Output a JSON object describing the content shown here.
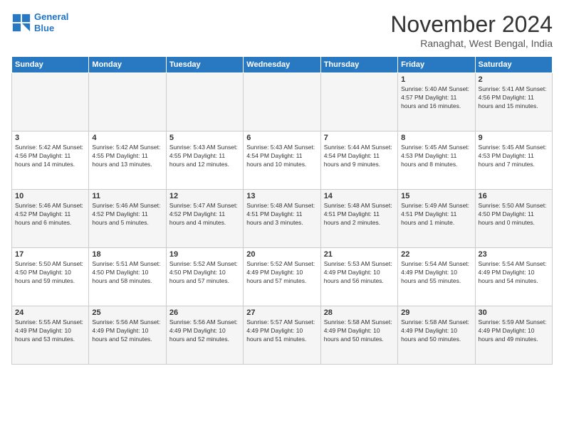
{
  "logo": {
    "line1": "General",
    "line2": "Blue"
  },
  "title": "November 2024",
  "subtitle": "Ranaghat, West Bengal, India",
  "headers": [
    "Sunday",
    "Monday",
    "Tuesday",
    "Wednesday",
    "Thursday",
    "Friday",
    "Saturday"
  ],
  "weeks": [
    [
      {
        "day": "",
        "content": ""
      },
      {
        "day": "",
        "content": ""
      },
      {
        "day": "",
        "content": ""
      },
      {
        "day": "",
        "content": ""
      },
      {
        "day": "",
        "content": ""
      },
      {
        "day": "1",
        "content": "Sunrise: 5:40 AM\nSunset: 4:57 PM\nDaylight: 11 hours\nand 16 minutes."
      },
      {
        "day": "2",
        "content": "Sunrise: 5:41 AM\nSunset: 4:56 PM\nDaylight: 11 hours\nand 15 minutes."
      }
    ],
    [
      {
        "day": "3",
        "content": "Sunrise: 5:42 AM\nSunset: 4:56 PM\nDaylight: 11 hours\nand 14 minutes."
      },
      {
        "day": "4",
        "content": "Sunrise: 5:42 AM\nSunset: 4:55 PM\nDaylight: 11 hours\nand 13 minutes."
      },
      {
        "day": "5",
        "content": "Sunrise: 5:43 AM\nSunset: 4:55 PM\nDaylight: 11 hours\nand 12 minutes."
      },
      {
        "day": "6",
        "content": "Sunrise: 5:43 AM\nSunset: 4:54 PM\nDaylight: 11 hours\nand 10 minutes."
      },
      {
        "day": "7",
        "content": "Sunrise: 5:44 AM\nSunset: 4:54 PM\nDaylight: 11 hours\nand 9 minutes."
      },
      {
        "day": "8",
        "content": "Sunrise: 5:45 AM\nSunset: 4:53 PM\nDaylight: 11 hours\nand 8 minutes."
      },
      {
        "day": "9",
        "content": "Sunrise: 5:45 AM\nSunset: 4:53 PM\nDaylight: 11 hours\nand 7 minutes."
      }
    ],
    [
      {
        "day": "10",
        "content": "Sunrise: 5:46 AM\nSunset: 4:52 PM\nDaylight: 11 hours\nand 6 minutes."
      },
      {
        "day": "11",
        "content": "Sunrise: 5:46 AM\nSunset: 4:52 PM\nDaylight: 11 hours\nand 5 minutes."
      },
      {
        "day": "12",
        "content": "Sunrise: 5:47 AM\nSunset: 4:52 PM\nDaylight: 11 hours\nand 4 minutes."
      },
      {
        "day": "13",
        "content": "Sunrise: 5:48 AM\nSunset: 4:51 PM\nDaylight: 11 hours\nand 3 minutes."
      },
      {
        "day": "14",
        "content": "Sunrise: 5:48 AM\nSunset: 4:51 PM\nDaylight: 11 hours\nand 2 minutes."
      },
      {
        "day": "15",
        "content": "Sunrise: 5:49 AM\nSunset: 4:51 PM\nDaylight: 11 hours\nand 1 minute."
      },
      {
        "day": "16",
        "content": "Sunrise: 5:50 AM\nSunset: 4:50 PM\nDaylight: 11 hours\nand 0 minutes."
      }
    ],
    [
      {
        "day": "17",
        "content": "Sunrise: 5:50 AM\nSunset: 4:50 PM\nDaylight: 10 hours\nand 59 minutes."
      },
      {
        "day": "18",
        "content": "Sunrise: 5:51 AM\nSunset: 4:50 PM\nDaylight: 10 hours\nand 58 minutes."
      },
      {
        "day": "19",
        "content": "Sunrise: 5:52 AM\nSunset: 4:50 PM\nDaylight: 10 hours\nand 57 minutes."
      },
      {
        "day": "20",
        "content": "Sunrise: 5:52 AM\nSunset: 4:49 PM\nDaylight: 10 hours\nand 57 minutes."
      },
      {
        "day": "21",
        "content": "Sunrise: 5:53 AM\nSunset: 4:49 PM\nDaylight: 10 hours\nand 56 minutes."
      },
      {
        "day": "22",
        "content": "Sunrise: 5:54 AM\nSunset: 4:49 PM\nDaylight: 10 hours\nand 55 minutes."
      },
      {
        "day": "23",
        "content": "Sunrise: 5:54 AM\nSunset: 4:49 PM\nDaylight: 10 hours\nand 54 minutes."
      }
    ],
    [
      {
        "day": "24",
        "content": "Sunrise: 5:55 AM\nSunset: 4:49 PM\nDaylight: 10 hours\nand 53 minutes."
      },
      {
        "day": "25",
        "content": "Sunrise: 5:56 AM\nSunset: 4:49 PM\nDaylight: 10 hours\nand 52 minutes."
      },
      {
        "day": "26",
        "content": "Sunrise: 5:56 AM\nSunset: 4:49 PM\nDaylight: 10 hours\nand 52 minutes."
      },
      {
        "day": "27",
        "content": "Sunrise: 5:57 AM\nSunset: 4:49 PM\nDaylight: 10 hours\nand 51 minutes."
      },
      {
        "day": "28",
        "content": "Sunrise: 5:58 AM\nSunset: 4:49 PM\nDaylight: 10 hours\nand 50 minutes."
      },
      {
        "day": "29",
        "content": "Sunrise: 5:58 AM\nSunset: 4:49 PM\nDaylight: 10 hours\nand 50 minutes."
      },
      {
        "day": "30",
        "content": "Sunrise: 5:59 AM\nSunset: 4:49 PM\nDaylight: 10 hours\nand 49 minutes."
      }
    ]
  ]
}
